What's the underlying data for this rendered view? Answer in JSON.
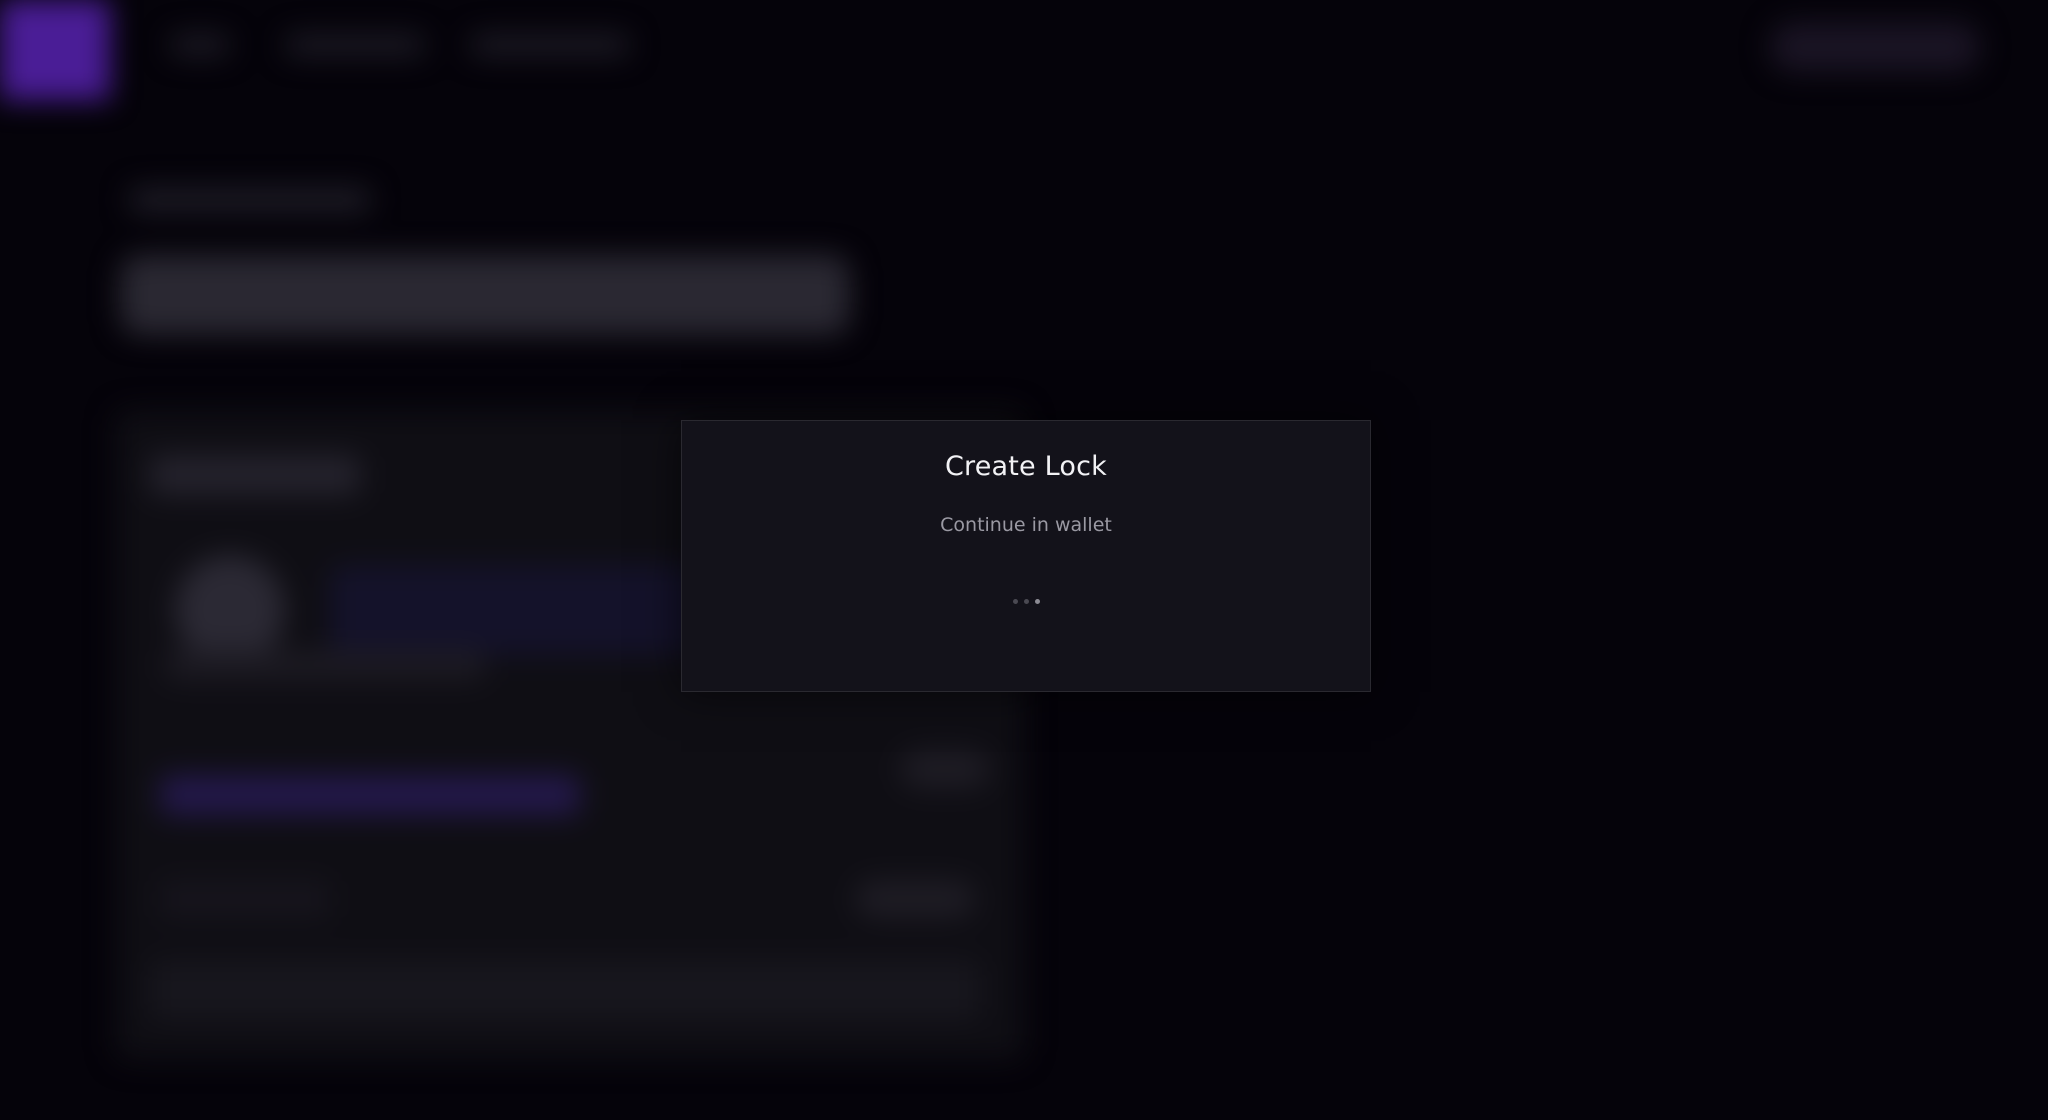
{
  "modal": {
    "title": "Create Lock",
    "subtitle": "Continue in wallet",
    "loading_indicator": "three-dot-loader"
  },
  "colors": {
    "page_background": "#05030a",
    "modal_background": "#13121a",
    "modal_border": "#2a2930",
    "brand_accent": "#4a1d96"
  }
}
